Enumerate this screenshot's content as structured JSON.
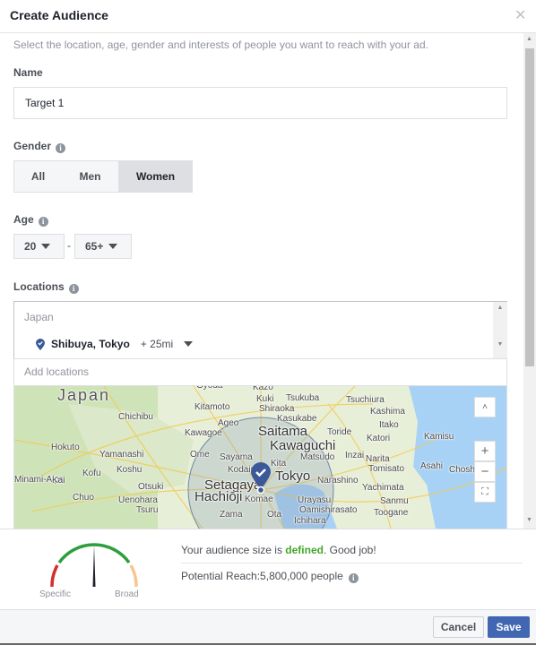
{
  "dialog": {
    "title": "Create Audience",
    "close_icon": "close-icon"
  },
  "description": "Select the location, age, gender and interests of people you want to reach with your ad.",
  "name": {
    "label": "Name",
    "value": "Target 1"
  },
  "gender": {
    "label": "Gender",
    "options": [
      "All",
      "Men",
      "Women"
    ],
    "selected": "Women"
  },
  "age": {
    "label": "Age",
    "min": "20",
    "separator": "-",
    "max": "65+"
  },
  "locations": {
    "label": "Locations",
    "country": "Japan",
    "selected_location": "Shibuya, Tokyo",
    "radius": "+ 25mi",
    "placeholder": "Add locations"
  },
  "map": {
    "labels": [
      "Japan",
      "Gyoda",
      "Kazo",
      "Kuki",
      "Tsukuba",
      "Kitamoto",
      "Shiraoka",
      "Tsuchiura",
      "Kashima",
      "Chichibu",
      "Ageo",
      "Kasukabe",
      "Itako",
      "Kawagoe",
      "Saitama",
      "Toride",
      "Katori",
      "Kamisu",
      "Hokuto",
      "Kawaguchi",
      "Yamanashi",
      "Ome",
      "Sayama",
      "Matsudo",
      "Inzai",
      "Narita",
      "Kita",
      "Asahi",
      "Choshi",
      "Kofu",
      "Koshu",
      "Kodaira",
      "Tomisato",
      "Tokyo",
      "Minami-Alps",
      "Kai",
      "Narashino",
      "Setagaya",
      "Otsuki",
      "Yachimata",
      "Hachiōji",
      "Chuo",
      "Uenohara",
      "Komae",
      "Urayasu",
      "Sanmu",
      "Tsuru",
      "Oamishirasato",
      "Toogane",
      "Zama",
      "Ota",
      "Ichihara"
    ],
    "controls": {
      "zoom_in": "+",
      "zoom_out": "−"
    },
    "colors": {
      "land": "#e8efd8",
      "water": "#a8d2f5",
      "pin": "#3b5998"
    }
  },
  "audience": {
    "gauge": {
      "left_label": "Specific",
      "right_label": "Broad",
      "level": 0.5
    },
    "status_prefix": "Your audience size is ",
    "status_word": "defined",
    "status_suffix": ". Good job!",
    "reach": "Potential Reach:5,800,000 people",
    "status_color": "#42a72a"
  },
  "buttons": {
    "cancel": "Cancel",
    "save": "Save"
  },
  "colors": {
    "primary": "#4267b2"
  }
}
